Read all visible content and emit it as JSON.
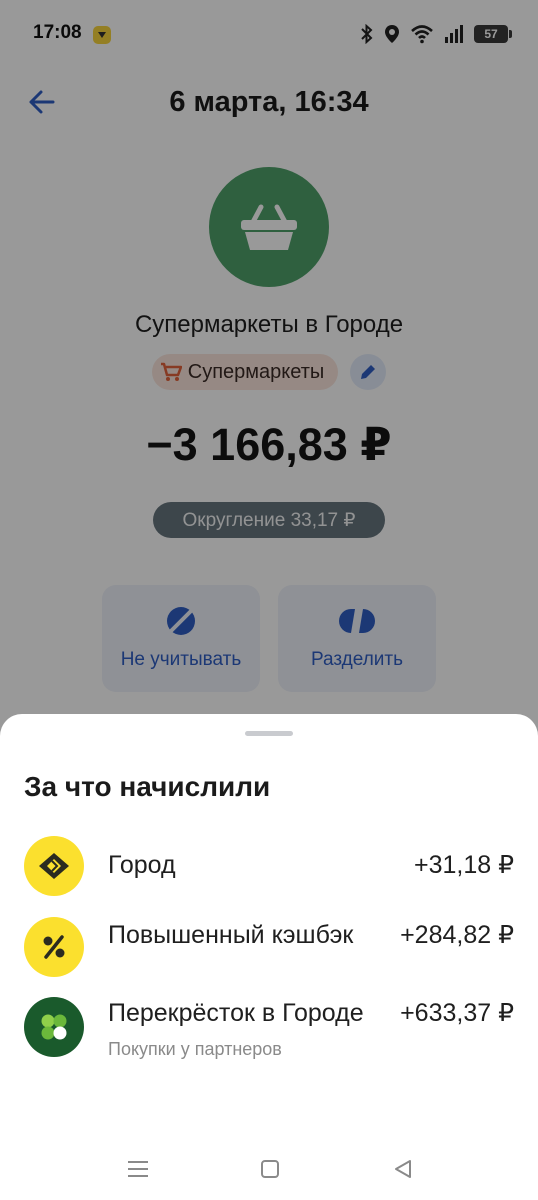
{
  "status_bar": {
    "time": "17:08",
    "battery": "57"
  },
  "header": {
    "title": "6 марта, 16:34"
  },
  "transaction": {
    "merchant": "Супермаркеты в Городе",
    "category": "Супермаркеты",
    "amount": "−3 166,83 ₽",
    "rounding": "Округление 33,17 ₽",
    "logo_color": "#4fa16a"
  },
  "actions": {
    "ignore_label": "Не учитывать",
    "split_label": "Разделить",
    "accent": "#2f5ec4"
  },
  "sheet": {
    "title": "За что начислили",
    "items": [
      {
        "title": "Город",
        "amount": "+31,18 ₽",
        "icon": "city-diamond-icon",
        "subtitle": ""
      },
      {
        "title": "Повышенный кэшбэк",
        "amount": "+284,82 ₽",
        "icon": "percent-icon",
        "subtitle": ""
      },
      {
        "title": "Перекрёсток в Городе",
        "amount": "+633,37 ₽",
        "icon": "perekrestok-clover-icon",
        "subtitle": "Покупки у партнеров"
      }
    ]
  }
}
